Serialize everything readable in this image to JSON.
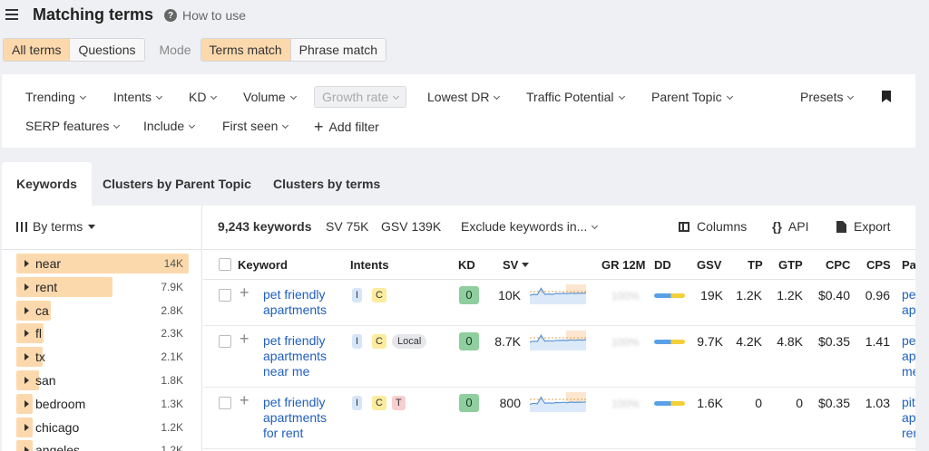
{
  "header": {
    "title": "Matching terms",
    "help": "How to use"
  },
  "modes": {
    "terms_tabs": [
      "All terms",
      "Questions"
    ],
    "mode_label": "Mode",
    "match_tabs": [
      "Terms match",
      "Phrase match"
    ]
  },
  "filters": {
    "row1": [
      "Trending",
      "Intents",
      "KD",
      "Volume",
      "Growth rate",
      "Lowest DR",
      "Traffic Potential",
      "Parent Topic"
    ],
    "presets": "Presets",
    "row2": [
      "SERP features",
      "Include",
      "First seen"
    ],
    "add_filter": "Add filter"
  },
  "tabs": [
    "Keywords",
    "Clusters by Parent Topic",
    "Clusters by terms"
  ],
  "sidebar": {
    "by_terms": "By terms",
    "terms": [
      {
        "name": "near",
        "count": "14K",
        "fill": 1.0
      },
      {
        "name": "rent",
        "count": "7.9K",
        "fill": 0.56
      },
      {
        "name": "ca",
        "count": "2.8K",
        "fill": 0.2
      },
      {
        "name": "fl",
        "count": "2.3K",
        "fill": 0.16
      },
      {
        "name": "tx",
        "count": "2.1K",
        "fill": 0.15
      },
      {
        "name": "san",
        "count": "1.8K",
        "fill": 0.13
      },
      {
        "name": "bedroom",
        "count": "1.3K",
        "fill": 0.09
      },
      {
        "name": "chicago",
        "count": "1.2K",
        "fill": 0.08
      },
      {
        "name": "angeles",
        "count": "1.2K",
        "fill": 0.08
      }
    ]
  },
  "summary": {
    "count": "9,243 keywords",
    "sv": "SV 75K",
    "gsv": "GSV 139K",
    "exclude": "Exclude keywords in...",
    "columns": "Columns",
    "api": "API",
    "export": "Export"
  },
  "columns": [
    "Keyword",
    "Intents",
    "KD",
    "SV",
    "GR 12M",
    "DD",
    "GSV",
    "TP",
    "GTP",
    "CPC",
    "CPS",
    "Pa"
  ],
  "rows": [
    {
      "keyword": "pet friendly apartments",
      "intents": [
        "I",
        "C"
      ],
      "kd": "0",
      "sv": "10K",
      "gr": "100%",
      "gsv": "19K",
      "tp": "1.2K",
      "gtp": "1.2K",
      "cpc": "$0.40",
      "cps": "0.96",
      "pa": "pet apartments"
    },
    {
      "keyword": "pet friendly apartments near me",
      "intents": [
        "I",
        "C",
        "Local"
      ],
      "kd": "0",
      "sv": "8.7K",
      "gr": "100%",
      "gsv": "9.7K",
      "tp": "4.2K",
      "gtp": "4.8K",
      "cpc": "$0.35",
      "cps": "1.41",
      "pa": "pet apartments me"
    },
    {
      "keyword": "pet friendly apartments for rent",
      "intents": [
        "I",
        "C",
        "T"
      ],
      "kd": "0",
      "sv": "800",
      "gr": "100%",
      "gsv": "1.6K",
      "tp": "0",
      "gtp": "0",
      "cpc": "$0.35",
      "cps": "1.03",
      "pa": "pit apartments rent"
    }
  ]
}
